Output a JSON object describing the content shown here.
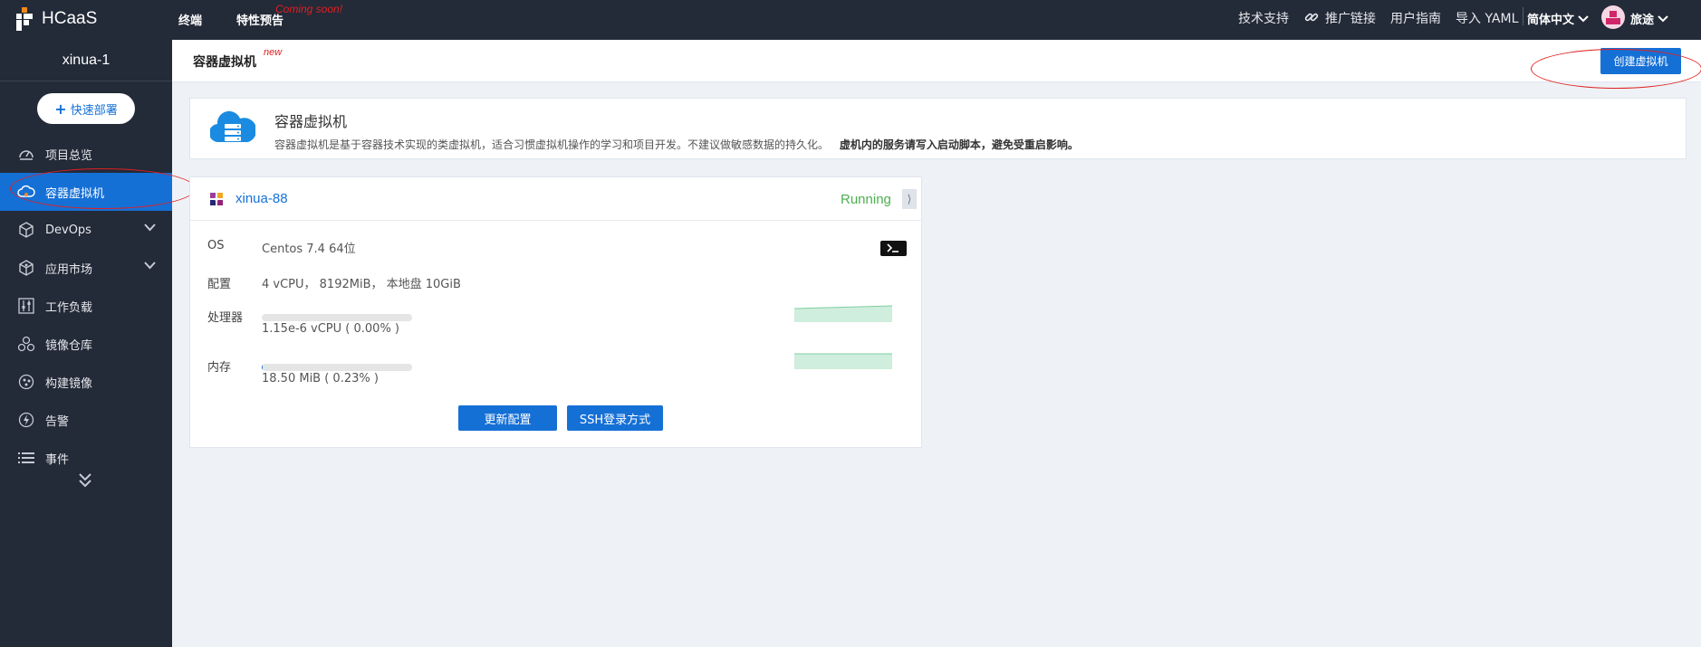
{
  "topbar": {
    "logo_text": "HCaaS",
    "nav": [
      "终端",
      "特性预告"
    ],
    "coming_soon": "Coming soon!",
    "links": [
      "技术支持",
      "推广链接",
      "用户指南",
      "导入 YAML"
    ],
    "language": "简体中文",
    "user": "旅途"
  },
  "sidebar": {
    "project": "xinua-1",
    "quick_deploy": "快速部署",
    "items": [
      {
        "label": "项目总览",
        "icon": "dashboard-icon",
        "expandable": false,
        "active": false
      },
      {
        "label": "容器虚拟机",
        "icon": "cloud-vm-icon",
        "expandable": false,
        "active": true
      },
      {
        "label": "DevOps",
        "icon": "cube-icon",
        "expandable": true,
        "active": false
      },
      {
        "label": "应用市场",
        "icon": "box-icon",
        "expandable": true,
        "active": false
      },
      {
        "label": "工作负载",
        "icon": "sliders-icon",
        "expandable": false,
        "active": false
      },
      {
        "label": "镜像仓库",
        "icon": "circles-icon",
        "expandable": false,
        "active": false
      },
      {
        "label": "构建镜像",
        "icon": "build-icon",
        "expandable": false,
        "active": false
      },
      {
        "label": "告警",
        "icon": "alert-icon",
        "expandable": false,
        "active": false
      },
      {
        "label": "事件",
        "icon": "list-icon",
        "expandable": false,
        "active": false
      }
    ]
  },
  "header": {
    "title": "容器虚拟机",
    "new_tag": "new",
    "create_button": "创建虚拟机"
  },
  "banner": {
    "title": "容器虚拟机",
    "description": "容器虚拟机是基于容器技术实现的类虚拟机，适合习惯虚拟机操作的学习和项目开发。不建议做敏感数据的持久化。",
    "warning": "虚机内的服务请写入启动脚本，避免受重启影响。"
  },
  "vm": {
    "name": "xinua-88",
    "status": "Running",
    "os_label": "OS",
    "os_value": "Centos 7.4 64位",
    "config_label": "配置",
    "config_value": "4 vCPU，  8192MiB，  本地盘 10GiB",
    "cpu_label": "处理器",
    "cpu_value": "1.15e-6 vCPU ( 0.00% )",
    "cpu_fraction": 0.0,
    "mem_label": "内存",
    "mem_value": "18.50 MiB ( 0.23% )",
    "mem_fraction": 0.0023,
    "update_button": "更新配置",
    "ssh_button": "SSH登录方式"
  },
  "colors": {
    "primary": "#1570d6",
    "topbar": "#232a38",
    "running": "#4caf50",
    "annotation": "#e02020"
  }
}
